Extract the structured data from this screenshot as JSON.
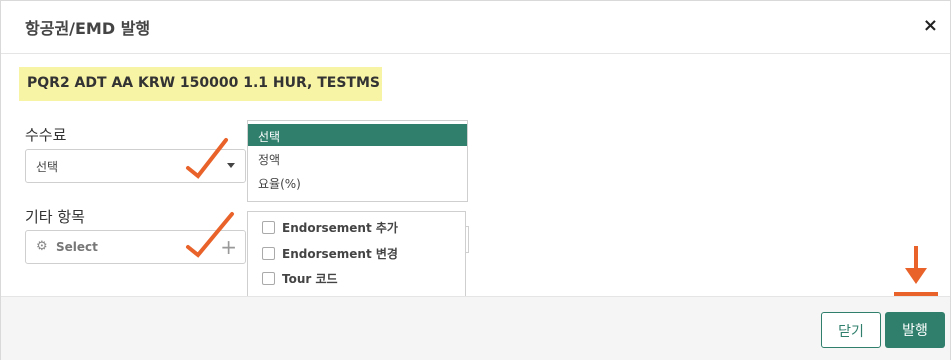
{
  "dialog": {
    "title": "항공권/EMD 발행",
    "close_symbol": "×"
  },
  "command_text": "PQR2 ADT AA KRW 150000 1.1 HUR, TESTMS",
  "fee": {
    "label": "수수료",
    "selected_value": "선택",
    "options": [
      {
        "label": "선택",
        "selected": true
      },
      {
        "label": "정액"
      },
      {
        "label": "요율(%)"
      }
    ]
  },
  "other_items": {
    "label": "기타 항목",
    "placeholder": "Select",
    "options": [
      {
        "label": "Endorsement 추가"
      },
      {
        "label": "Endorsement 변경"
      },
      {
        "label": "Tour 코드"
      }
    ]
  },
  "footer": {
    "close_label": "닫기",
    "issue_label": "발행"
  },
  "colors": {
    "accent": "#2f7f6c",
    "highlight": "#f8f4a6",
    "annotation_arrow": "#e8622a"
  },
  "icons": {
    "gear": "gear-icon",
    "plus": "plus-icon",
    "caret": "caret-down-icon",
    "close": "close-icon"
  }
}
